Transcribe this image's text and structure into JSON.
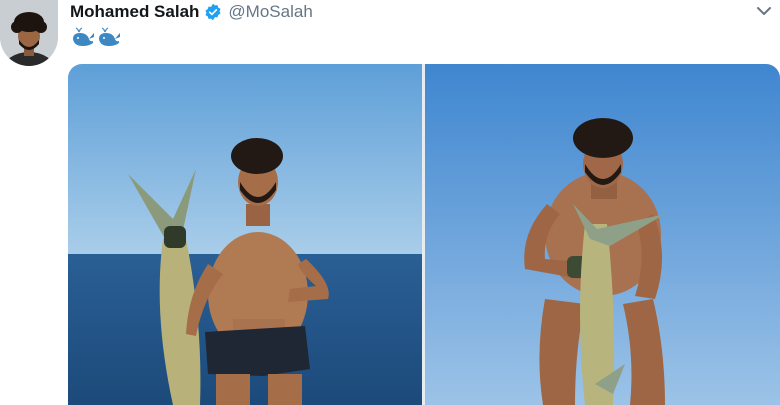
{
  "tweet": {
    "author": {
      "display_name": "Mohamed Salah",
      "handle": "@MoSalah",
      "verified": true,
      "avatar_icon": "profile-photo"
    },
    "text_emoji": [
      "whale-icon",
      "whale-icon"
    ],
    "menu_icon": "chevron-down-icon",
    "media": [
      {
        "name": "photo-left",
        "icon": "photo-man-holding-fish-sea"
      },
      {
        "name": "photo-right",
        "icon": "photo-man-holding-fish-sky"
      }
    ]
  },
  "colors": {
    "verified_blue": "#1da1f2",
    "handle_gray": "#657786",
    "name_black": "#14171a",
    "whale_blue": "#3b88c3"
  }
}
